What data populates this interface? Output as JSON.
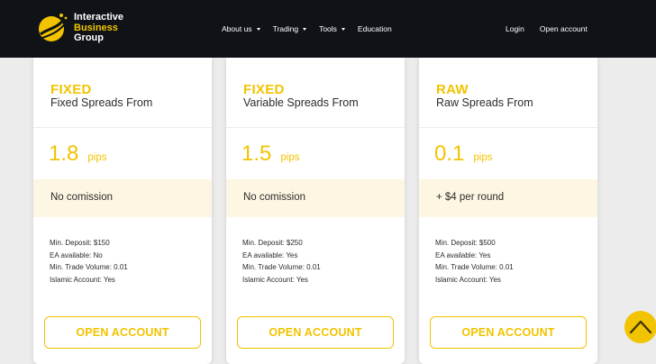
{
  "brand": {
    "line1": "Interactive",
    "line2": "Business",
    "line3": "Group"
  },
  "nav": {
    "main": [
      {
        "label": "About us",
        "dropdown": true
      },
      {
        "label": "Trading",
        "dropdown": true
      },
      {
        "label": "Tools",
        "dropdown": true
      },
      {
        "label": "Education",
        "dropdown": false
      }
    ],
    "login": "Login",
    "open_account": "Open account"
  },
  "plans": [
    {
      "type": "FIXED",
      "description": "Fixed Spreads From",
      "value": "1.8",
      "unit": "pips",
      "fee": "No comission",
      "specs": [
        "Min. Deposit: $150",
        "EA available: No",
        "Min. Trade Volume: 0.01",
        "Islamic Account: Yes"
      ],
      "button": "OPEN ACCOUNT"
    },
    {
      "type": "FIXED",
      "description": "Variable Spreads From",
      "value": "1.5",
      "unit": "pips",
      "fee": "No comission",
      "specs": [
        "Min. Deposit: $250",
        "EA available: Yes",
        "Min. Trade Volume: 0.01",
        "Islamic Account: Yes"
      ],
      "button": "OPEN ACCOUNT"
    },
    {
      "type": "RAW",
      "description": "Raw Spreads From",
      "value": "0.1",
      "unit": "pips",
      "fee": "+ $4 per round",
      "specs": [
        "Min. Deposit: $500",
        "EA available: Yes",
        "Min. Trade Volume: 0.01",
        "Islamic Account: Yes"
      ],
      "button": "OPEN ACCOUNT"
    }
  ],
  "icons": {
    "logo": "ibg-logo-icon",
    "dropdown": "caret-down-icon",
    "scroll_top": "chevron-up-icon"
  },
  "colors": {
    "accent": "#f2c300",
    "topbar": "#0f1317",
    "fee_band": "#fdf6e2",
    "page": "#ececec"
  }
}
